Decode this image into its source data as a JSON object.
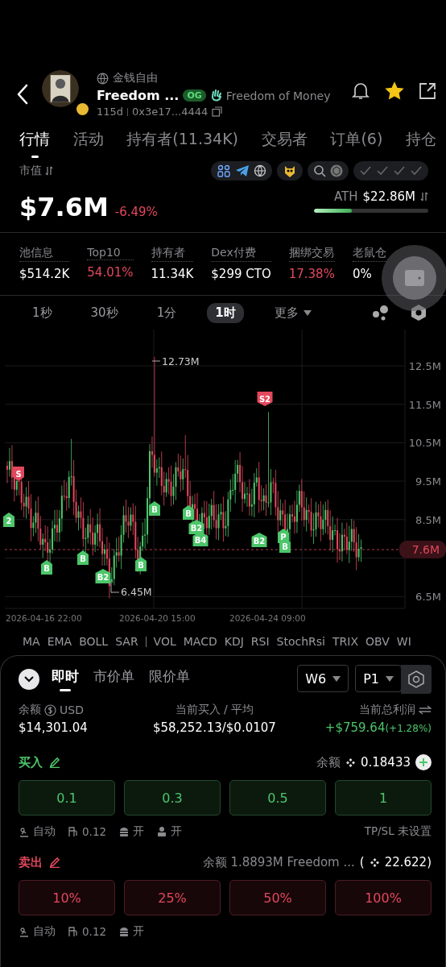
{
  "header": {
    "subtitle": "金钱自由",
    "name": "Freedom ...",
    "badge": "OG",
    "full_name": "Freedom of Money",
    "age": "115d",
    "address": "0x3e17...4444",
    "starred": true
  },
  "tabs": [
    {
      "label": "行情",
      "selected": true
    },
    {
      "label": "活动",
      "selected": false
    },
    {
      "label": "持有者(11.34K)",
      "selected": false
    },
    {
      "label": "交易者",
      "selected": false
    },
    {
      "label": "订单(6)",
      "selected": false
    },
    {
      "label": "持仓",
      "selected": false
    }
  ],
  "market_cap": {
    "label": "市值",
    "value": "$7.6M",
    "change": "-6.49%",
    "ath_label": "ATH",
    "ath_value": "$22.86M",
    "level": 0.33
  },
  "stats": [
    {
      "label": "池信息",
      "value": "$514.2K",
      "alert": false
    },
    {
      "label": "Top10",
      "value": "54.01%",
      "alert": true
    },
    {
      "label": "持有者",
      "value": "11.34K",
      "alert": false
    },
    {
      "label": "Dex付费",
      "value": "$299 CTO",
      "alert": false
    },
    {
      "label": "捆绑交易",
      "value": "17.38%",
      "alert": true
    },
    {
      "label": "老鼠仓",
      "value": "0%",
      "alert": false
    }
  ],
  "intervals": [
    {
      "label": "1秒",
      "selected": false,
      "kind": "interval"
    },
    {
      "label": "30秒",
      "selected": false,
      "kind": "interval"
    },
    {
      "label": "1分",
      "selected": false,
      "kind": "interval"
    },
    {
      "label": "1时",
      "selected": true,
      "kind": "interval"
    },
    {
      "label": "更多",
      "selected": false,
      "kind": "menu"
    }
  ],
  "chart": {
    "y_labels": [
      "12.5M",
      "11.5M",
      "10.5M",
      "9.5M",
      "8.5M",
      "6.5M"
    ],
    "x_labels": [
      "2026-04-16 22:00",
      "2026-04-20 15:00",
      "2026-04-24 09:00"
    ],
    "high_label": "12.73M",
    "low_label": "6.45M",
    "price_tag": "7.6M",
    "markers": [
      {
        "label": "S",
        "kind": "sell"
      },
      {
        "label": "2",
        "kind": "buy"
      },
      {
        "label": "B",
        "kind": "buy"
      },
      {
        "label": "B",
        "kind": "buy"
      },
      {
        "label": "B2",
        "kind": "buy"
      },
      {
        "label": "B",
        "kind": "buy"
      },
      {
        "label": "B",
        "kind": "buy"
      },
      {
        "label": "B",
        "kind": "buy"
      },
      {
        "label": "B2",
        "kind": "buy"
      },
      {
        "label": "B4",
        "kind": "buy"
      },
      {
        "label": "S2",
        "kind": "sell"
      },
      {
        "label": "B2",
        "kind": "buy"
      },
      {
        "label": "P",
        "kind": "buy"
      },
      {
        "label": "B",
        "kind": "buy"
      }
    ]
  },
  "main_indicators": [
    "MA",
    "EMA",
    "BOLL",
    "SAR"
  ],
  "sub_indicators": [
    "VOL",
    "MACD",
    "KDJ",
    "RSI",
    "StochRsi",
    "TRIX",
    "OBV",
    "WI"
  ],
  "trade": {
    "tabs": [
      {
        "label": "即时",
        "selected": true
      },
      {
        "label": "市价单",
        "selected": false
      },
      {
        "label": "限价单",
        "selected": false
      }
    ],
    "wallet": "W6",
    "preset": "P1",
    "balance_label": "余额",
    "balance_currency": "USD",
    "balance": "$14,301.04",
    "bought_label": "当前买入 / 平均",
    "bought": "$58,252.13/$0.0107",
    "profit_label": "当前总利润",
    "profit": "+$759.64",
    "profit_pct": "(+1.28%)",
    "buy": {
      "label": "买入",
      "balance_label": "余额",
      "balance": "0.18433",
      "amounts": [
        "0.1",
        "0.3",
        "0.5",
        "1"
      ],
      "settings": [
        {
          "kind": "auto",
          "text": "自动"
        },
        {
          "kind": "gas",
          "text": "0.12"
        },
        {
          "kind": "mev",
          "text": "开"
        },
        {
          "kind": "user",
          "text": "开"
        }
      ],
      "tpsl": "TP/SL 未设置"
    },
    "sell": {
      "label": "卖出",
      "balance_text": "余额 1.8893M Freedom ...",
      "balance_prefix": "(",
      "balance": "22.622)",
      "amounts": [
        "10%",
        "25%",
        "50%",
        "100%"
      ],
      "settings": [
        {
          "kind": "auto",
          "text": "自动"
        },
        {
          "kind": "gas",
          "text": "0.12"
        },
        {
          "kind": "mev",
          "text": "开"
        }
      ]
    }
  }
}
